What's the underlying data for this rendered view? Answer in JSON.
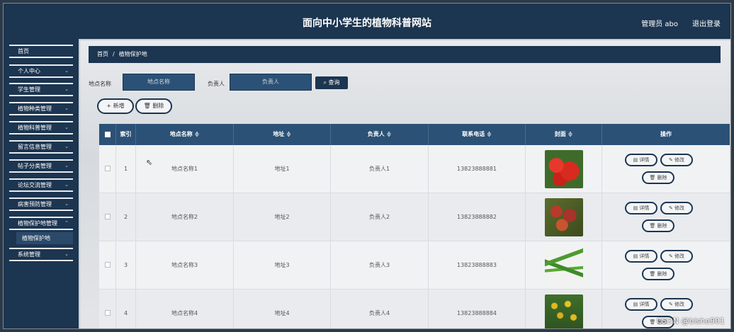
{
  "header": {
    "title": "面向中小学生的植物科普网站",
    "admin_label": "管理员 abo",
    "logout_label": "退出登录"
  },
  "sidebar": {
    "items": [
      {
        "label": "首页",
        "has_chevron": false
      },
      {
        "label": "个人中心",
        "has_chevron": true
      },
      {
        "label": "学生管理",
        "has_chevron": true
      },
      {
        "label": "植物种类管理",
        "has_chevron": true
      },
      {
        "label": "植物科普管理",
        "has_chevron": true
      },
      {
        "label": "留言信息管理",
        "has_chevron": true
      },
      {
        "label": "帖子分类管理",
        "has_chevron": true
      },
      {
        "label": "论坛交流管理",
        "has_chevron": true
      },
      {
        "label": "病害预防管理",
        "has_chevron": true
      },
      {
        "label": "植物保护地管理",
        "has_chevron": true
      },
      {
        "label": "系统管理",
        "has_chevron": true
      }
    ],
    "sub_item": "植物保护地"
  },
  "breadcrumb": {
    "home": "首页",
    "separator": "/",
    "current": "植物保护地"
  },
  "search": {
    "name_label": "地点名称",
    "name_placeholder": "地点名称",
    "person_label": "负责人",
    "person_placeholder": "负责人",
    "button_label": "查询"
  },
  "actions": {
    "add_label": "新增",
    "delete_label": "删除"
  },
  "table": {
    "columns": [
      "索引",
      "地点名称 ≑",
      "地址 ≑",
      "负责人 ≑",
      "联系电话 ≑",
      "封面 ≑",
      "操作"
    ],
    "rows": [
      {
        "index": "1",
        "name": "地点名称1",
        "address": "地址1",
        "person": "负责人1",
        "phone": "13823888881",
        "cover": "tomato"
      },
      {
        "index": "2",
        "name": "地点名称2",
        "address": "地址2",
        "person": "负责人2",
        "phone": "13823888882",
        "cover": "flytrap"
      },
      {
        "index": "3",
        "name": "地点名称3",
        "address": "地址3",
        "person": "负责人3",
        "phone": "13823888883",
        "cover": "beans"
      },
      {
        "index": "4",
        "name": "地点名称4",
        "address": "地址4",
        "person": "负责人4",
        "phone": "13823888884",
        "cover": "flowers"
      }
    ],
    "row_actions": {
      "detail": "详情",
      "edit": "修改",
      "remove": "删除"
    }
  },
  "watermark": "CSDN @bishe901",
  "colors": {
    "primary": "#1c3550",
    "header_row": "#2b5176"
  }
}
